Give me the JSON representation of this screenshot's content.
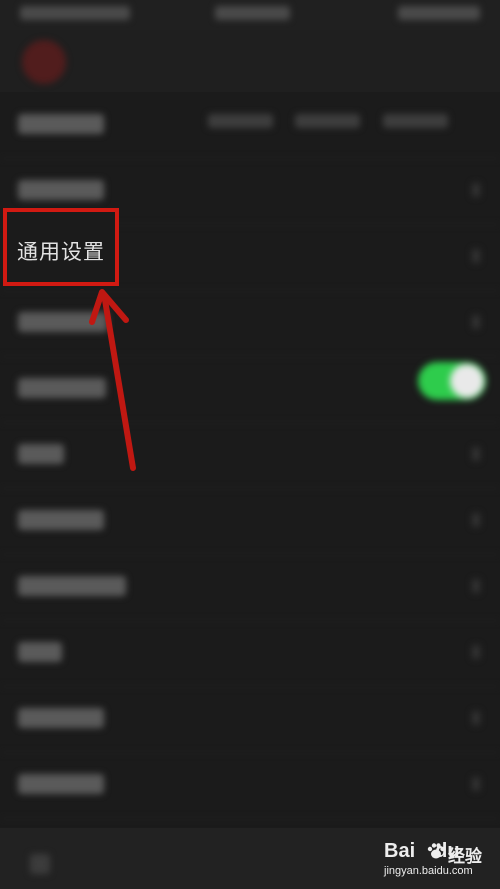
{
  "highlighted_item": {
    "label": "通用设置"
  },
  "toggle": {
    "state": "on",
    "color": "#2ecc4c"
  },
  "annotation": {
    "box_color": "#d11a12",
    "arrow_color": "#c01812"
  },
  "watermark": {
    "brand_bai": "Bai",
    "brand_du": "du",
    "brand_cn": "经验",
    "url": "jingyan.baidu.com"
  }
}
